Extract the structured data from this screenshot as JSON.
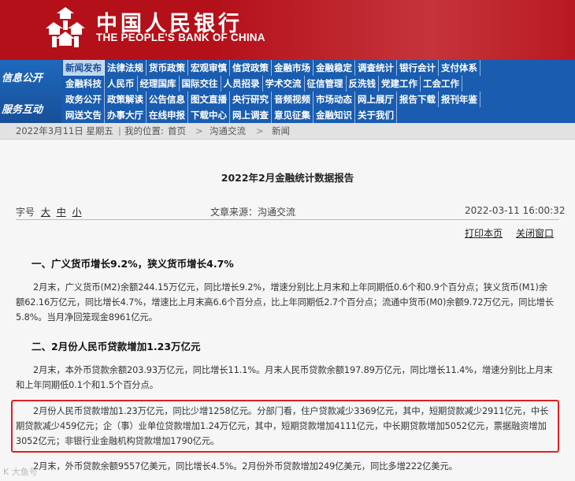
{
  "header": {
    "title_cn": "中国人民银行",
    "title_en": "THE PEOPLE'S BANK OF CHINA",
    "brand_color": "#b4101a"
  },
  "nav": {
    "left_labels": [
      "信息公开",
      "服务互动"
    ],
    "rows": [
      [
        "新闻发布",
        "法律法规",
        "货币政策",
        "宏观审慎",
        "信贷政策",
        "金融市场",
        "金融稳定",
        "调查统计",
        "银行会计",
        "支付体系"
      ],
      [
        "金融科技",
        "人民币",
        "经理国库",
        "国际交往",
        "人员招录",
        "学术交流",
        "征信管理",
        "反洗钱",
        "党建工作",
        "工会工作"
      ],
      [
        "政务公开",
        "政策解读",
        "公告信息",
        "图文直播",
        "央行研究",
        "音频视频",
        "市场动态",
        "网上展厅",
        "报告下载",
        "报刊年鉴"
      ],
      [
        "网送文告",
        "办事大厅",
        "在线申报",
        "下载中心",
        "网上调查",
        "意见征集",
        "金融知识",
        "关于我们"
      ]
    ],
    "selected": "新闻发布"
  },
  "topbar": {
    "date": "2022年3月11日 星期五",
    "location_label": "我的位置:",
    "crumb_home": "首页",
    "crumb_section": "沟通交流",
    "crumb_page": "新闻"
  },
  "article": {
    "title": "2022年2月金融统计数据报告",
    "font_label": "字号",
    "font_large": "大",
    "font_medium": "中",
    "font_small": "小",
    "source": "文章来源：沟通交流",
    "datetime": "2022-03-11 16:00:32",
    "print": "打印本页",
    "close": "关闭窗口",
    "h1": "一、广义货币增长9.2%，狭义货币增长4.7%",
    "p1": "2月末，广义货币(M2)余额244.15万亿元，同比增长9.2%，增速分别比上月末和上年同期低0.6个和0.9个百分点；狭义货币(M1)余额62.16万亿元，同比增长4.7%，增速比上月末高6.6个百分点，比上年同期低2.7个百分点；流通中货币(M0)余额9.72万亿元，同比增长5.8%。当月净回笼现金8961亿元。",
    "h2": "二、2月份人民币贷款增加1.23万亿元",
    "p2": "2月末，本外币贷款余额203.93万亿元，同比增长11.1%。月末人民币贷款余额197.89万亿元，同比增长11.4%，增速分别比上月末和上年同期低0.1个和1.5个百分点。",
    "p3": "2月份人民币贷款增加1.23万亿元，同比少增1258亿元。分部门看，住户贷款减少3369亿元，其中，短期贷款减少2911亿元，中长期贷款减少459亿元；企（事）业单位贷款增加1.24万亿元，其中，短期贷款增加4111亿元，中长期贷款增加5052亿元，票据融资增加3052亿元；非银行业金融机构贷款增加1790亿元。",
    "p4": "2月末，外币贷款余额9557亿美元，同比增长4.5%。2月份外币贷款增加249亿美元，同比多增222亿美元。"
  },
  "watermark": "K 大鱼号",
  "highlight_color": "#e02020"
}
